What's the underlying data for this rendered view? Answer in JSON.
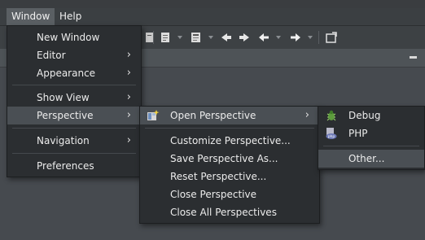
{
  "menubar": {
    "items": [
      {
        "label": "Window"
      },
      {
        "label": "Help"
      }
    ]
  },
  "window_menu": {
    "items": [
      {
        "label": "New Window"
      },
      {
        "label": "Editor",
        "submenu_arrow": "›"
      },
      {
        "label": "Appearance",
        "submenu_arrow": "›"
      },
      {
        "label": "Show View",
        "submenu_arrow": "›"
      },
      {
        "label": "Perspective",
        "submenu_arrow": "›"
      },
      {
        "label": "Navigation",
        "submenu_arrow": "›"
      },
      {
        "label": "Preferences"
      }
    ]
  },
  "perspective_menu": {
    "items": [
      {
        "label": "Open Perspective",
        "submenu_arrow": "›",
        "icon": "open-perspective-icon"
      },
      {
        "label": "Customize Perspective..."
      },
      {
        "label": "Save Perspective As..."
      },
      {
        "label": "Reset Perspective..."
      },
      {
        "label": "Close Perspective"
      },
      {
        "label": "Close All Perspectives"
      }
    ]
  },
  "open_perspective_menu": {
    "items": [
      {
        "label": "Debug",
        "icon": "debug-bug-icon"
      },
      {
        "label": "PHP",
        "icon": "php-icon"
      },
      {
        "label": "Other..."
      }
    ]
  },
  "colors": {
    "menu_bg": "#2b2e31",
    "highlight": "#4a4f54",
    "menubar_bg": "#3b3f42",
    "workspace": "#464a4f"
  }
}
